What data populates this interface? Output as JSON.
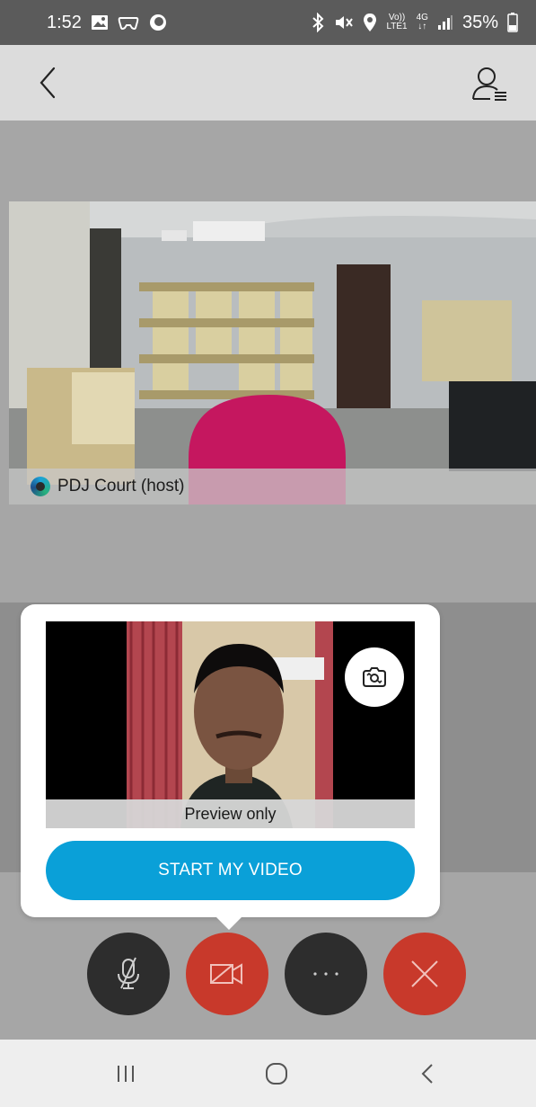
{
  "status_bar": {
    "time": "1:52",
    "battery": "35%",
    "volte": "Vo))",
    "lte": "LTE1",
    "network": "4G"
  },
  "header": {
    "back_icon": "chevron-left-icon",
    "participants_icon": "participants-list-icon"
  },
  "remote": {
    "name": "PDJ Court (host)"
  },
  "preview": {
    "label": "Preview only",
    "start_button": "START MY VIDEO"
  },
  "controls": {
    "mute": "mic-muted-icon",
    "video": "video-off-icon",
    "more": "more-icon",
    "leave": "close-icon"
  },
  "colors": {
    "accent": "#0aa0d8",
    "danger": "#c8392b",
    "dark_control": "#2d2d2d"
  }
}
